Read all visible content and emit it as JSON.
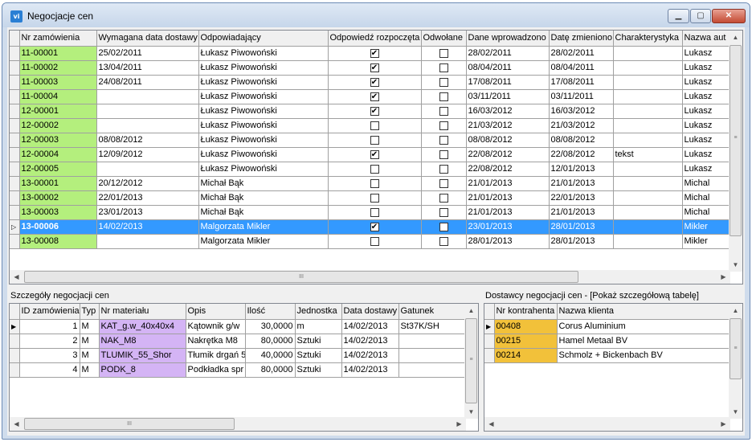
{
  "window": {
    "title": "Negocjacje cen",
    "icon": "app-icon",
    "icon_text": "vi"
  },
  "top_grid": {
    "columns": [
      "Nr zamówienia",
      "Wymagana data dostawy",
      "Odpowiadający",
      "Odpowiedź rozpoczęta",
      "Odwołane",
      "Dane wprowadzono",
      "Datę zmieniono",
      "Charakterystyka",
      "Nazwa aut"
    ],
    "rows": [
      [
        "11-00001",
        "25/02/2011",
        "Łukasz Piwowoński",
        true,
        false,
        "28/02/2011",
        "28/02/2011",
        "",
        "Lukasz"
      ],
      [
        "11-00002",
        "13/04/2011",
        "Łukasz Piwowoński",
        true,
        false,
        "08/04/2011",
        "08/04/2011",
        "",
        "Lukasz"
      ],
      [
        "11-00003",
        "24/08/2011",
        "Łukasz Piwowoński",
        true,
        false,
        "17/08/2011",
        "17/08/2011",
        "",
        "Lukasz"
      ],
      [
        "11-00004",
        "",
        "Łukasz Piwowoński",
        true,
        false,
        "03/11/2011",
        "03/11/2011",
        "",
        "Lukasz"
      ],
      [
        "12-00001",
        "",
        "Łukasz Piwowoński",
        true,
        false,
        "16/03/2012",
        "16/03/2012",
        "",
        "Lukasz"
      ],
      [
        "12-00002",
        "",
        "Łukasz Piwowoński",
        false,
        false,
        "21/03/2012",
        "21/03/2012",
        "",
        "Lukasz"
      ],
      [
        "12-00003",
        "08/08/2012",
        "Łukasz Piwowoński",
        false,
        false,
        "08/08/2012",
        "08/08/2012",
        "",
        "Lukasz"
      ],
      [
        "12-00004",
        "12/09/2012",
        "Łukasz Piwowoński",
        true,
        false,
        "22/08/2012",
        "22/08/2012",
        "tekst",
        "Lukasz"
      ],
      [
        "12-00005",
        "",
        "Łukasz Piwowoński",
        false,
        false,
        "22/08/2012",
        "12/01/2013",
        "",
        "Lukasz"
      ],
      [
        "13-00001",
        "20/12/2012",
        "Michał Bąk",
        false,
        false,
        "21/01/2013",
        "21/01/2013",
        "",
        "Michal"
      ],
      [
        "13-00002",
        "22/01/2013",
        "Michał Bąk",
        false,
        false,
        "21/01/2013",
        "22/01/2013",
        "",
        "Michal"
      ],
      [
        "13-00003",
        "23/01/2013",
        "Michał Bąk",
        false,
        false,
        "21/01/2013",
        "21/01/2013",
        "",
        "Michal"
      ],
      [
        "13-00006",
        "14/02/2013",
        "Malgorzata Mikler",
        true,
        false,
        "23/01/2013",
        "28/01/2013",
        "",
        "Mikler"
      ],
      [
        "13-00008",
        "",
        "Malgorzata Mikler",
        false,
        false,
        "28/01/2013",
        "28/01/2013",
        "",
        "Mikler"
      ]
    ],
    "selected_row": 12
  },
  "details_panel": {
    "label": "Szczegóły negocjacji cen",
    "columns": [
      "ID zamówienia",
      "Typ",
      "Nr materiału",
      "Opis",
      "Ilość",
      "Jednostka",
      "Data dostawy",
      "Gatunek"
    ],
    "rows": [
      [
        "1",
        "M",
        "KAT_g.w_40x40x4",
        "Kątownik g/w",
        "30,0000",
        "m",
        "14/02/2013",
        "St37K/SH"
      ],
      [
        "2",
        "M",
        "NAK_M8",
        "Nakrętka M8",
        "80,0000",
        "Sztuki",
        "14/02/2013",
        ""
      ],
      [
        "3",
        "M",
        "TLUMIK_55_Shor",
        "Tłumik drgań 5",
        "40,0000",
        "Sztuki",
        "14/02/2013",
        ""
      ],
      [
        "4",
        "M",
        "PODK_8",
        "Podkładka spr",
        "80,0000",
        "Sztuki",
        "14/02/2013",
        ""
      ]
    ]
  },
  "suppliers_panel": {
    "label": "Dostawcy negocjacji cen - [Pokaż szczegółową tabelę]",
    "columns": [
      "Nr kontrahenta",
      "Nazwa klienta"
    ],
    "rows": [
      [
        "00408",
        "Corus Aluminium"
      ],
      [
        "00215",
        "Hamel Metaal BV"
      ],
      [
        "00214",
        "Schmolz + Bickenbach BV"
      ]
    ]
  },
  "glyphs": {
    "check": "✔",
    "row_current": "▶",
    "row_selected": "▷",
    "scroll_up": "▲",
    "scroll_down": "▼",
    "scroll_left": "◀",
    "scroll_right": "▶",
    "grip": "≡",
    "hgrip": "III",
    "min": "▁",
    "max": "▢",
    "close": "✕"
  },
  "colors": {
    "selection": "#3399ff",
    "order_cell": "#b4ef7d",
    "material_cell": "#d4b4f5",
    "supplier_cell": "#f2c13a"
  }
}
